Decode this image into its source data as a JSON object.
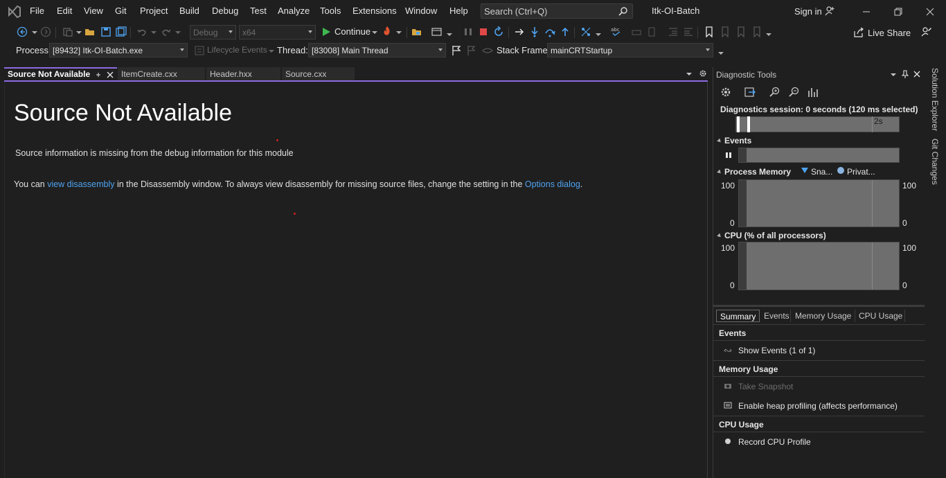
{
  "menu": [
    "File",
    "Edit",
    "View",
    "Git",
    "Project",
    "Build",
    "Debug",
    "Test",
    "Analyze",
    "Tools",
    "Extensions",
    "Window",
    "Help"
  ],
  "search_placeholder": "Search (Ctrl+Q)",
  "window_title": "Itk-OI-Batch",
  "sign_in": "Sign in",
  "toolbar": {
    "config": "Debug",
    "platform": "x64",
    "continue": "Continue",
    "live_share": "Live Share"
  },
  "debug_location": {
    "process_label": "Process:",
    "process_value": "[89432] Itk-OI-Batch.exe",
    "lifecycle": "Lifecycle Events",
    "thread_label": "Thread:",
    "thread_value": "[83008] Main Thread",
    "stack_label": "Stack Frame:",
    "stack_value": "mainCRTStartup"
  },
  "doc_tabs": [
    "Source Not Available",
    "ItemCreate.cxx",
    "Header.hxx",
    "Source.cxx"
  ],
  "editor": {
    "heading": "Source Not Available",
    "missing": "Source information is missing from the debug information for this module",
    "line_prefix": "You can ",
    "link1": "view disassembly",
    "line_mid": " in the Disassembly window. To always view disassembly for missing source files, change the setting in the ",
    "link2": "Options dialog",
    "line_suffix": "."
  },
  "diag": {
    "title": "Diagnostic Tools",
    "session": "Diagnostics session: 0 seconds (120 ms selected)",
    "timeline_label": "2s",
    "events": "Events",
    "process_memory": "Process Memory",
    "legend_snapshot": "Sna...",
    "legend_private": "Privat...",
    "cpu": "CPU (% of all processors)",
    "axis_max": "100",
    "axis_min": "0",
    "tabs": [
      "Summary",
      "Events",
      "Memory Usage",
      "CPU Usage"
    ],
    "events_header": "Events",
    "show_events": "Show Events (1 of 1)",
    "memory_header": "Memory Usage",
    "take_snapshot": "Take Snapshot",
    "heap_profiling": "Enable heap profiling (affects performance)",
    "cpu_header": "CPU Usage",
    "record_cpu": "Record CPU Profile"
  },
  "side_tabs": [
    "Solution Explorer",
    "Git Changes"
  ],
  "colors": {
    "accent": "#8d6ae3",
    "link": "#4fa3f0",
    "stop": "#e04848",
    "play": "#3fb950"
  }
}
